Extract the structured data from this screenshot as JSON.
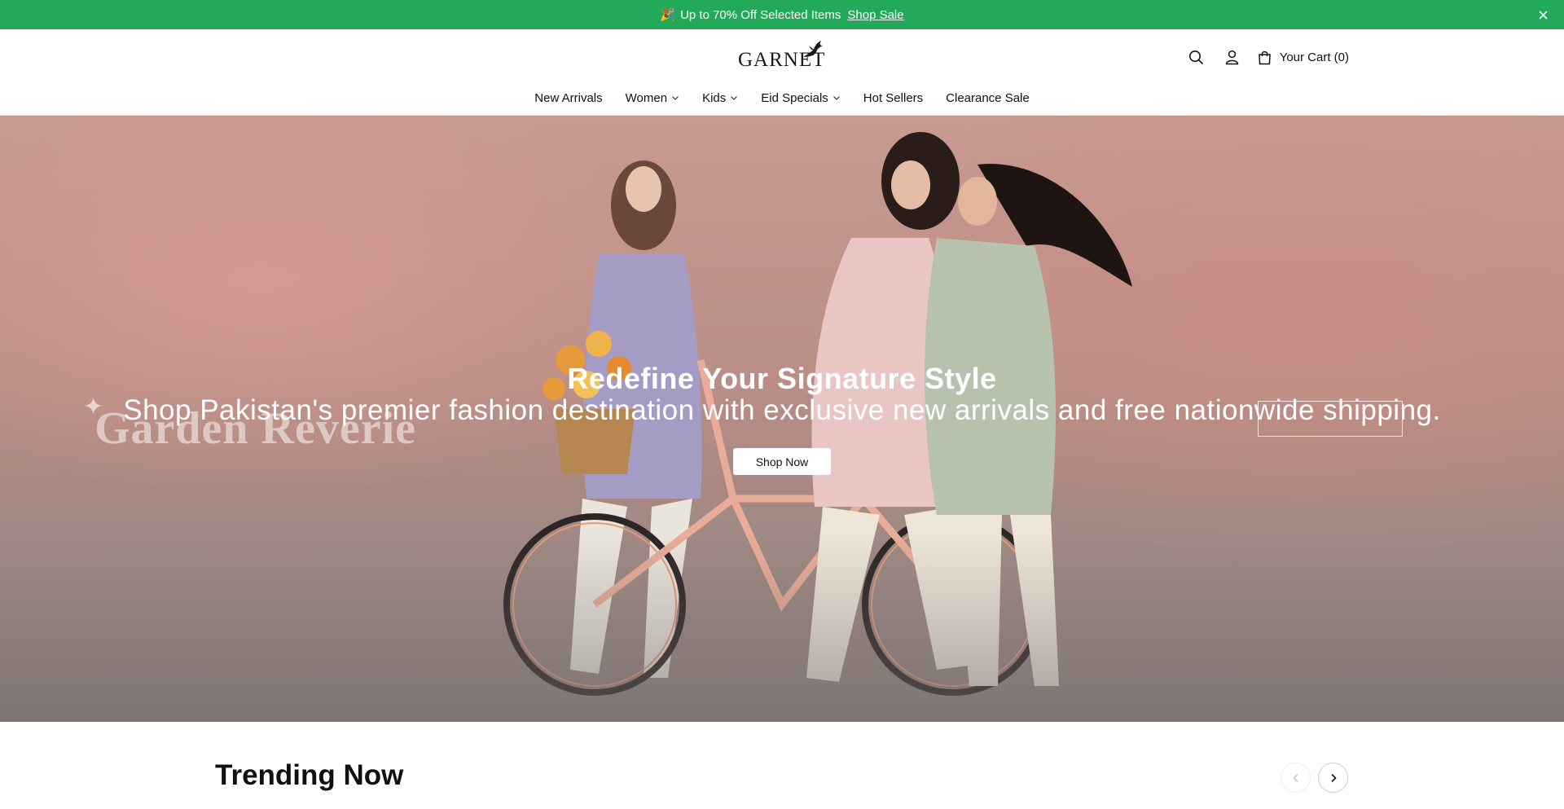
{
  "announcement": {
    "emoji": "🎉",
    "text": "Up to 70% Off Selected Items",
    "link_label": "Shop Sale",
    "close_icon": "close-icon"
  },
  "header": {
    "logo_text": "GARNET",
    "cart_label": "Your Cart (0)",
    "icons": [
      "search-icon",
      "account-icon",
      "cart-bag-icon"
    ]
  },
  "nav": {
    "items": [
      {
        "label": "New Arrivals",
        "has_dropdown": false
      },
      {
        "label": "Women",
        "has_dropdown": true
      },
      {
        "label": "Kids",
        "has_dropdown": true
      },
      {
        "label": "Eid Specials",
        "has_dropdown": true
      },
      {
        "label": "Hot Sellers",
        "has_dropdown": false
      },
      {
        "label": "Clearance Sale",
        "has_dropdown": false
      }
    ]
  },
  "hero": {
    "image_brand_text": "Garden Reverie",
    "heading": "Redefine Your Signature Style",
    "subheading": "Shop Pakistan's premier fashion destination with exclusive new arrivals and free nationwide shipping.",
    "button_label": "Shop Now"
  },
  "trending": {
    "title": "Trending Now"
  },
  "colors": {
    "announcement_bg": "#22a95a",
    "text": "#111111",
    "hero_tone": "#c89a91"
  }
}
